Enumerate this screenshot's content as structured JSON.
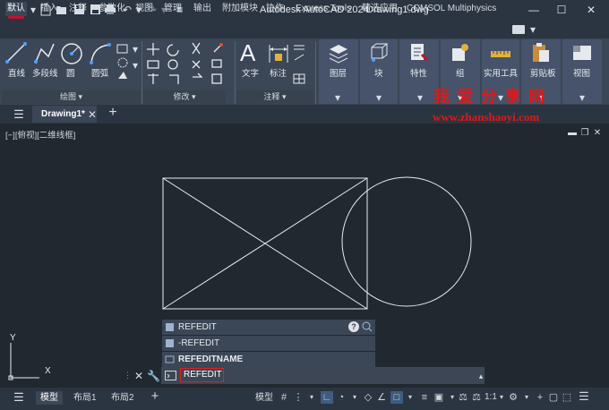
{
  "app": {
    "logo": "A",
    "title": "Autodesk AutoCAD 2024",
    "document": "Drawing1.dwg"
  },
  "ribbon_tabs": [
    "默认",
    "插入",
    "注释",
    "参数化",
    "视图",
    "管理",
    "输出",
    "附加模块",
    "协作",
    "Express Tools",
    "精选应用",
    "COMSOL Multiphysics"
  ],
  "ribbon": {
    "draw": {
      "line": "直线",
      "polyline": "多段线",
      "circle": "圆",
      "arc": "圆弧",
      "panel": "绘图 ▾"
    },
    "modify": {
      "panel": "修改 ▾"
    },
    "annotation": {
      "text": "文字",
      "dimension": "标注",
      "panel": "注释 ▾"
    },
    "layers": "图层",
    "block": "块",
    "properties": "特性",
    "group": "组",
    "utilities": "实用工具",
    "clipboard": "剪贴板",
    "view": "视图"
  },
  "file_tabs": {
    "active": "Drawing1*",
    "add": "+"
  },
  "viewport": {
    "label": "[−][俯视][二维线框]"
  },
  "ucs": {
    "x": "X",
    "y": "Y"
  },
  "command": {
    "suggestions": [
      "REFEDIT",
      "-REFEDIT",
      "REFEDITNAME"
    ],
    "input": "REFEDIT"
  },
  "status": {
    "layout_tabs": [
      "模型",
      "布局1",
      "布局2"
    ],
    "model_label": "模型",
    "scale": "1:1"
  },
  "watermark": {
    "line1": "我 爱 分 享 网",
    "line2": "www.zhanshaoyi.com"
  },
  "colors": {
    "accent": "#c8102e",
    "background": "#212830",
    "ribbon": "#3b4656",
    "watermark": "#e01818"
  }
}
